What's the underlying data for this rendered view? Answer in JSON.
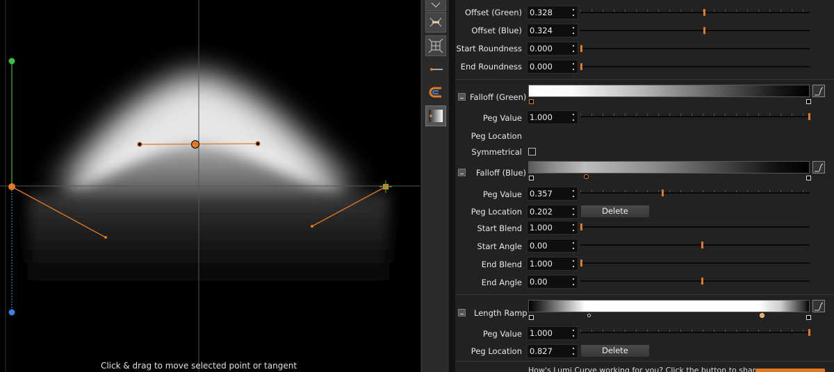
{
  "canvas": {
    "hint": "Click & drag to move selected point or tangent"
  },
  "toolbar": {
    "tools": [
      "fit-view-icon",
      "extend-icon",
      "frame-icon",
      "line-tool-icon",
      "magnet-icon",
      "gradient-icon"
    ]
  },
  "properties": {
    "offset_green": {
      "label": "Offset (Green)",
      "value": "0.328",
      "slider": 0.54
    },
    "offset_blue": {
      "label": "Offset (Blue)",
      "value": "0.324",
      "slider": 0.54
    },
    "start_roundness": {
      "label": "Start Roundness",
      "value": "0.000",
      "slider": 0.0
    },
    "end_roundness": {
      "label": "End Roundness",
      "value": "0.000",
      "slider": 0.0
    },
    "falloff_green": {
      "label": "Falloff (Green)",
      "peg_value": {
        "label": "Peg Value",
        "value": "1.000",
        "slider": 1.0
      },
      "peg_location": {
        "label": "Peg Location"
      },
      "symmetrical": {
        "label": "Symmetrical",
        "checked": false
      }
    },
    "falloff_blue": {
      "label": "Falloff (Blue)",
      "peg_value": {
        "label": "Peg Value",
        "value": "0.357",
        "slider": 0.357
      },
      "peg_location": {
        "label": "Peg Location",
        "value": "0.202",
        "delete": "Delete"
      },
      "start_blend": {
        "label": "Start Blend",
        "value": "1.000",
        "slider": 0.0
      },
      "start_angle": {
        "label": "Start Angle",
        "value": "0.00",
        "slider": 0.53
      },
      "end_blend": {
        "label": "End Blend",
        "value": "1.000",
        "slider": 0.0
      },
      "end_angle": {
        "label": "End Angle",
        "value": "0.00",
        "slider": 0.53
      }
    },
    "length_ramp": {
      "label": "Length Ramp",
      "peg_value": {
        "label": "Peg Value",
        "value": "1.000",
        "slider": 1.0
      },
      "peg_location": {
        "label": "Peg Location",
        "value": "0.827",
        "delete": "Delete"
      }
    },
    "footer_text": "How's Lumi Curve working for you? Click the button to share"
  },
  "colors": {
    "accent": "#e07a24",
    "green_axis": "#3fbf3f",
    "blue_axis": "#3b7fe0"
  }
}
